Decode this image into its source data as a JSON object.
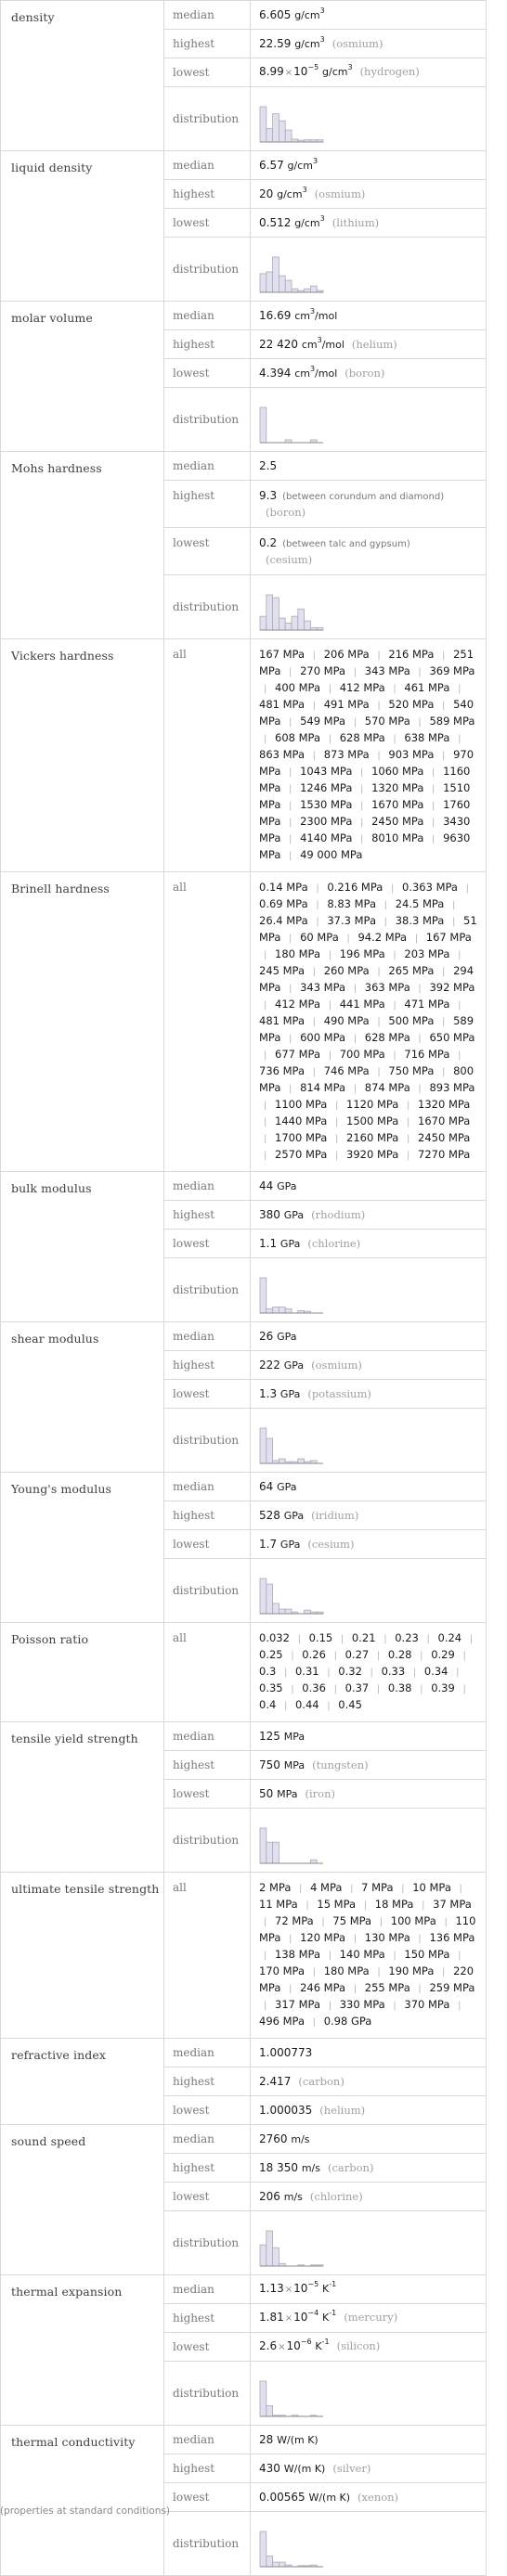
{
  "footnote": "(properties at standard conditions)",
  "labels": {
    "median": "median",
    "highest": "highest",
    "lowest": "lowest",
    "distribution": "distribution",
    "all": "all"
  },
  "properties": [
    {
      "name": "density",
      "type": "stats",
      "median": {
        "num": "6.605",
        "unit": "g/cm",
        "sup": "3"
      },
      "highest": {
        "num": "22.59",
        "unit": "g/cm",
        "sup": "3",
        "element": "(osmium)"
      },
      "lowest": {
        "num": "8.99",
        "exp": "−5",
        "unit": "g/cm",
        "sup": "3",
        "element": "(hydrogen)"
      },
      "distribution": [
        1.0,
        0.38,
        0.8,
        0.6,
        0.34,
        0.08,
        0.05,
        0.06,
        0.06,
        0.06
      ]
    },
    {
      "name": "liquid density",
      "type": "stats",
      "median": {
        "num": "6.57",
        "unit": "g/cm",
        "sup": "3"
      },
      "highest": {
        "num": "20",
        "unit": "g/cm",
        "sup": "3",
        "element": "(osmium)"
      },
      "lowest": {
        "num": "0.512",
        "unit": "g/cm",
        "sup": "3",
        "element": "(lithium)"
      },
      "distribution": [
        0.53,
        0.58,
        1.0,
        0.47,
        0.34,
        0.1,
        0.05,
        0.1,
        0.18,
        0.05
      ]
    },
    {
      "name": "molar volume",
      "type": "stats",
      "median": {
        "num": "16.69",
        "unit": "cm",
        "sup": "3",
        "unit2": "/mol"
      },
      "highest": {
        "num": "22420",
        "display": "22 420",
        "unit": "cm",
        "sup": "3",
        "unit2": "/mol",
        "element": "(helium)"
      },
      "lowest": {
        "num": "4.394",
        "unit": "cm",
        "sup": "3",
        "unit2": "/mol",
        "element": "(boron)"
      },
      "distribution": [
        1.0,
        0,
        0,
        0,
        0.08,
        0,
        0,
        0,
        0.08,
        0
      ]
    },
    {
      "name": "Mohs hardness",
      "type": "stats",
      "median": {
        "num": "2.5"
      },
      "highest": {
        "num": "9.3",
        "qualifier": "(between corundum and diamond)",
        "element": "(boron)"
      },
      "lowest": {
        "num": "0.2",
        "qualifier": "(between talc and gypsum)",
        "element": "(cesium)"
      },
      "distribution": [
        0.39,
        1.0,
        0.92,
        0.34,
        0.2,
        0.39,
        0.6,
        0.26,
        0.07,
        0.07
      ]
    },
    {
      "name": "Vickers hardness",
      "type": "list",
      "values": [
        "167 MPa",
        "206 MPa",
        "216 MPa",
        "251 MPa",
        "270 MPa",
        "343 MPa",
        "369 MPa",
        "400 MPa",
        "412 MPa",
        "461 MPa",
        "481 MPa",
        "491 MPa",
        "520 MPa",
        "540 MPa",
        "549 MPa",
        "570 MPa",
        "589 MPa",
        "608 MPa",
        "628 MPa",
        "638 MPa",
        "863 MPa",
        "873 MPa",
        "903 MPa",
        "970 MPa",
        "1043 MPa",
        "1060 MPa",
        "1160 MPa",
        "1246 MPa",
        "1320 MPa",
        "1510 MPa",
        "1530 MPa",
        "1670 MPa",
        "1760 MPa",
        "2300 MPa",
        "2450 MPa",
        "3430 MPa",
        "4140 MPa",
        "8010 MPa",
        "9630 MPa",
        "49 000 MPa"
      ]
    },
    {
      "name": "Brinell hardness",
      "type": "list",
      "values": [
        "0.14 MPa",
        "0.216 MPa",
        "0.363 MPa",
        "0.69 MPa",
        "8.83 MPa",
        "24.5 MPa",
        "26.4 MPa",
        "37.3 MPa",
        "38.3 MPa",
        "51 MPa",
        "60 MPa",
        "94.2 MPa",
        "167 MPa",
        "180 MPa",
        "196 MPa",
        "203 MPa",
        "245 MPa",
        "260 MPa",
        "265 MPa",
        "294 MPa",
        "343 MPa",
        "363 MPa",
        "392 MPa",
        "412 MPa",
        "441 MPa",
        "471 MPa",
        "481 MPa",
        "490 MPa",
        "500 MPa",
        "589 MPa",
        "600 MPa",
        "628 MPa",
        "650 MPa",
        "677 MPa",
        "700 MPa",
        "716 MPa",
        "736 MPa",
        "746 MPa",
        "750 MPa",
        "800 MPa",
        "814 MPa",
        "874 MPa",
        "893 MPa",
        "1100 MPa",
        "1120 MPa",
        "1320 MPa",
        "1440 MPa",
        "1500 MPa",
        "1670 MPa",
        "1700 MPa",
        "2160 MPa",
        "2450 MPa",
        "2570 MPa",
        "3920 MPa",
        "7270 MPa"
      ]
    },
    {
      "name": "bulk modulus",
      "type": "stats",
      "median": {
        "num": "44",
        "unit": "GPa"
      },
      "highest": {
        "num": "380",
        "unit": "GPa",
        "element": "(rhodium)"
      },
      "lowest": {
        "num": "1.1",
        "unit": "GPa",
        "element": "(chlorine)"
      },
      "distribution": [
        1.0,
        0.12,
        0.17,
        0.17,
        0.12,
        0,
        0.07,
        0.05,
        0,
        0
      ]
    },
    {
      "name": "shear modulus",
      "type": "stats",
      "median": {
        "num": "26",
        "unit": "GPa"
      },
      "highest": {
        "num": "222",
        "unit": "GPa",
        "element": "(osmium)"
      },
      "lowest": {
        "num": "1.3",
        "unit": "GPa",
        "element": "(potassium)"
      },
      "distribution": [
        1.0,
        0.71,
        0.08,
        0.13,
        0.05,
        0.05,
        0.13,
        0.05,
        0.08,
        0
      ]
    },
    {
      "name": "Young's modulus",
      "type": "stats",
      "median": {
        "num": "64",
        "unit": "GPa"
      },
      "highest": {
        "num": "528",
        "unit": "GPa",
        "element": "(iridium)"
      },
      "lowest": {
        "num": "1.7",
        "unit": "GPa",
        "element": "(cesium)"
      },
      "distribution": [
        1.0,
        0.84,
        0.29,
        0.13,
        0.13,
        0.05,
        0,
        0.1,
        0.05,
        0.05
      ]
    },
    {
      "name": "Poisson ratio",
      "type": "list",
      "values": [
        "0.032",
        "0.15",
        "0.21",
        "0.23",
        "0.24",
        "0.25",
        "0.26",
        "0.27",
        "0.28",
        "0.29",
        "0.3",
        "0.31",
        "0.32",
        "0.33",
        "0.34",
        "0.35",
        "0.36",
        "0.37",
        "0.38",
        "0.39",
        "0.4",
        "0.44",
        "0.45"
      ]
    },
    {
      "name": "tensile yield strength",
      "type": "stats",
      "median": {
        "num": "125",
        "unit": "MPa"
      },
      "highest": {
        "num": "750",
        "unit": "MPa",
        "element": "(tungsten)"
      },
      "lowest": {
        "num": "50",
        "unit": "MPa",
        "element": "(iron)"
      },
      "distribution": [
        1.0,
        0.6,
        0.6,
        0,
        0,
        0,
        0,
        0,
        0.1,
        0
      ]
    },
    {
      "name": "ultimate tensile strength",
      "type": "list",
      "values": [
        "2 MPa",
        "4 MPa",
        "7 MPa",
        "10 MPa",
        "11 MPa",
        "15 MPa",
        "18 MPa",
        "37 MPa",
        "72 MPa",
        "75 MPa",
        "100 MPa",
        "110 MPa",
        "120 MPa",
        "130 MPa",
        "136 MPa",
        "138 MPa",
        "140 MPa",
        "150 MPa",
        "170 MPa",
        "180 MPa",
        "190 MPa",
        "220 MPa",
        "246 MPa",
        "255 MPa",
        "259 MPa",
        "317 MPa",
        "330 MPa",
        "370 MPa",
        "496 MPa",
        "0.98 GPa"
      ]
    },
    {
      "name": "refractive index",
      "type": "stats",
      "median": {
        "num": "1.000773"
      },
      "highest": {
        "num": "2.417",
        "element": "(carbon)"
      },
      "lowest": {
        "num": "1.000035",
        "element": "(helium)"
      }
    },
    {
      "name": "sound speed",
      "type": "stats",
      "median": {
        "num": "2760",
        "unit": "m/s"
      },
      "highest": {
        "num": "18350",
        "display": "18 350",
        "unit": "m/s",
        "element": "(carbon)"
      },
      "lowest": {
        "num": "206",
        "unit": "m/s",
        "element": "(chlorine)"
      },
      "distribution": [
        0.6,
        1.0,
        0.52,
        0.07,
        0,
        0,
        0.03,
        0,
        0.03,
        0.03
      ]
    },
    {
      "name": "thermal expansion",
      "type": "stats",
      "median": {
        "num": "1.13",
        "exp": "−5",
        "unit": "K",
        "sup": "-1"
      },
      "highest": {
        "num": "1.81",
        "exp": "−4",
        "unit": "K",
        "sup": "-1",
        "element": "(mercury)"
      },
      "lowest": {
        "num": "2.6",
        "exp": "−6",
        "unit": "K",
        "sup": "-1",
        "element": "(silicon)"
      },
      "distribution": [
        1.0,
        0.3,
        0.03,
        0.03,
        0,
        0.03,
        0,
        0,
        0.03,
        0
      ]
    },
    {
      "name": "thermal conductivity",
      "type": "stats",
      "median": {
        "num": "28",
        "unit": "W/(m K)"
      },
      "highest": {
        "num": "430",
        "unit": "W/(m K)",
        "element": "(silver)"
      },
      "lowest": {
        "num": "0.00565",
        "unit": "W/(m K)",
        "element": "(xenon)"
      },
      "distribution": [
        1.0,
        0.3,
        0.13,
        0.13,
        0.05,
        0,
        0.03,
        0.03,
        0.05,
        0
      ]
    }
  ]
}
